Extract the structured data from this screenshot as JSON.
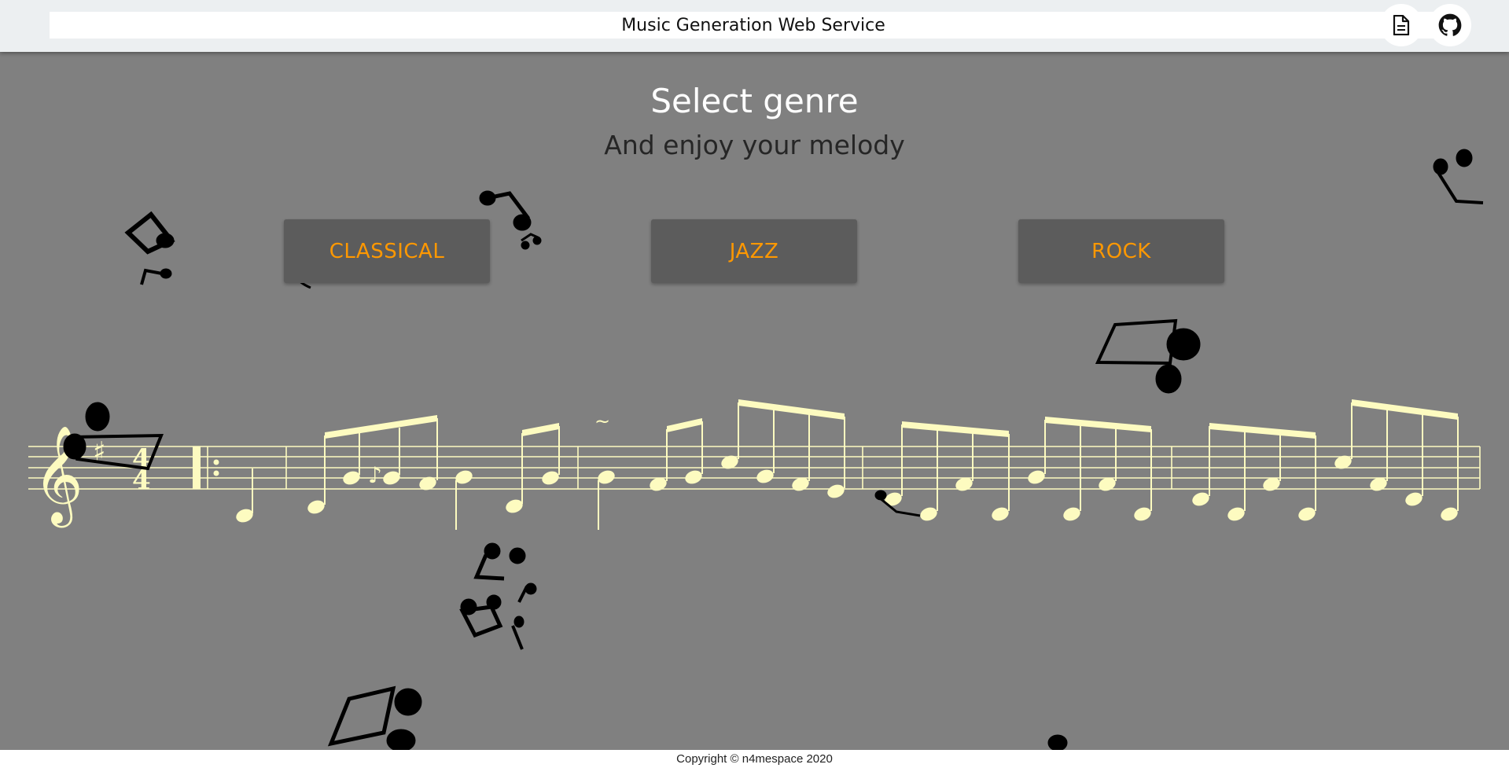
{
  "header": {
    "title": "Music Generation Web Service",
    "docs_icon": "document-icon",
    "github_icon": "github-icon"
  },
  "main": {
    "heading": "Select genre",
    "subheading": "And enjoy your melody",
    "genres": [
      {
        "label": "CLASSICAL"
      },
      {
        "label": "JAZZ"
      },
      {
        "label": "ROCK"
      }
    ],
    "score": {
      "clef": "treble-clef",
      "key_signature": "F#",
      "time_signature": "4/4"
    }
  },
  "footer": {
    "copyright": "Copyright © n4mespace 2020"
  },
  "colors": {
    "background": "#808080",
    "header_bg": "#eceff1",
    "button_bg": "#5c5c5c",
    "button_text": "#ff9800",
    "score_color": "#fdfbc0",
    "heading": "#ffffff",
    "subheading": "#262626"
  }
}
